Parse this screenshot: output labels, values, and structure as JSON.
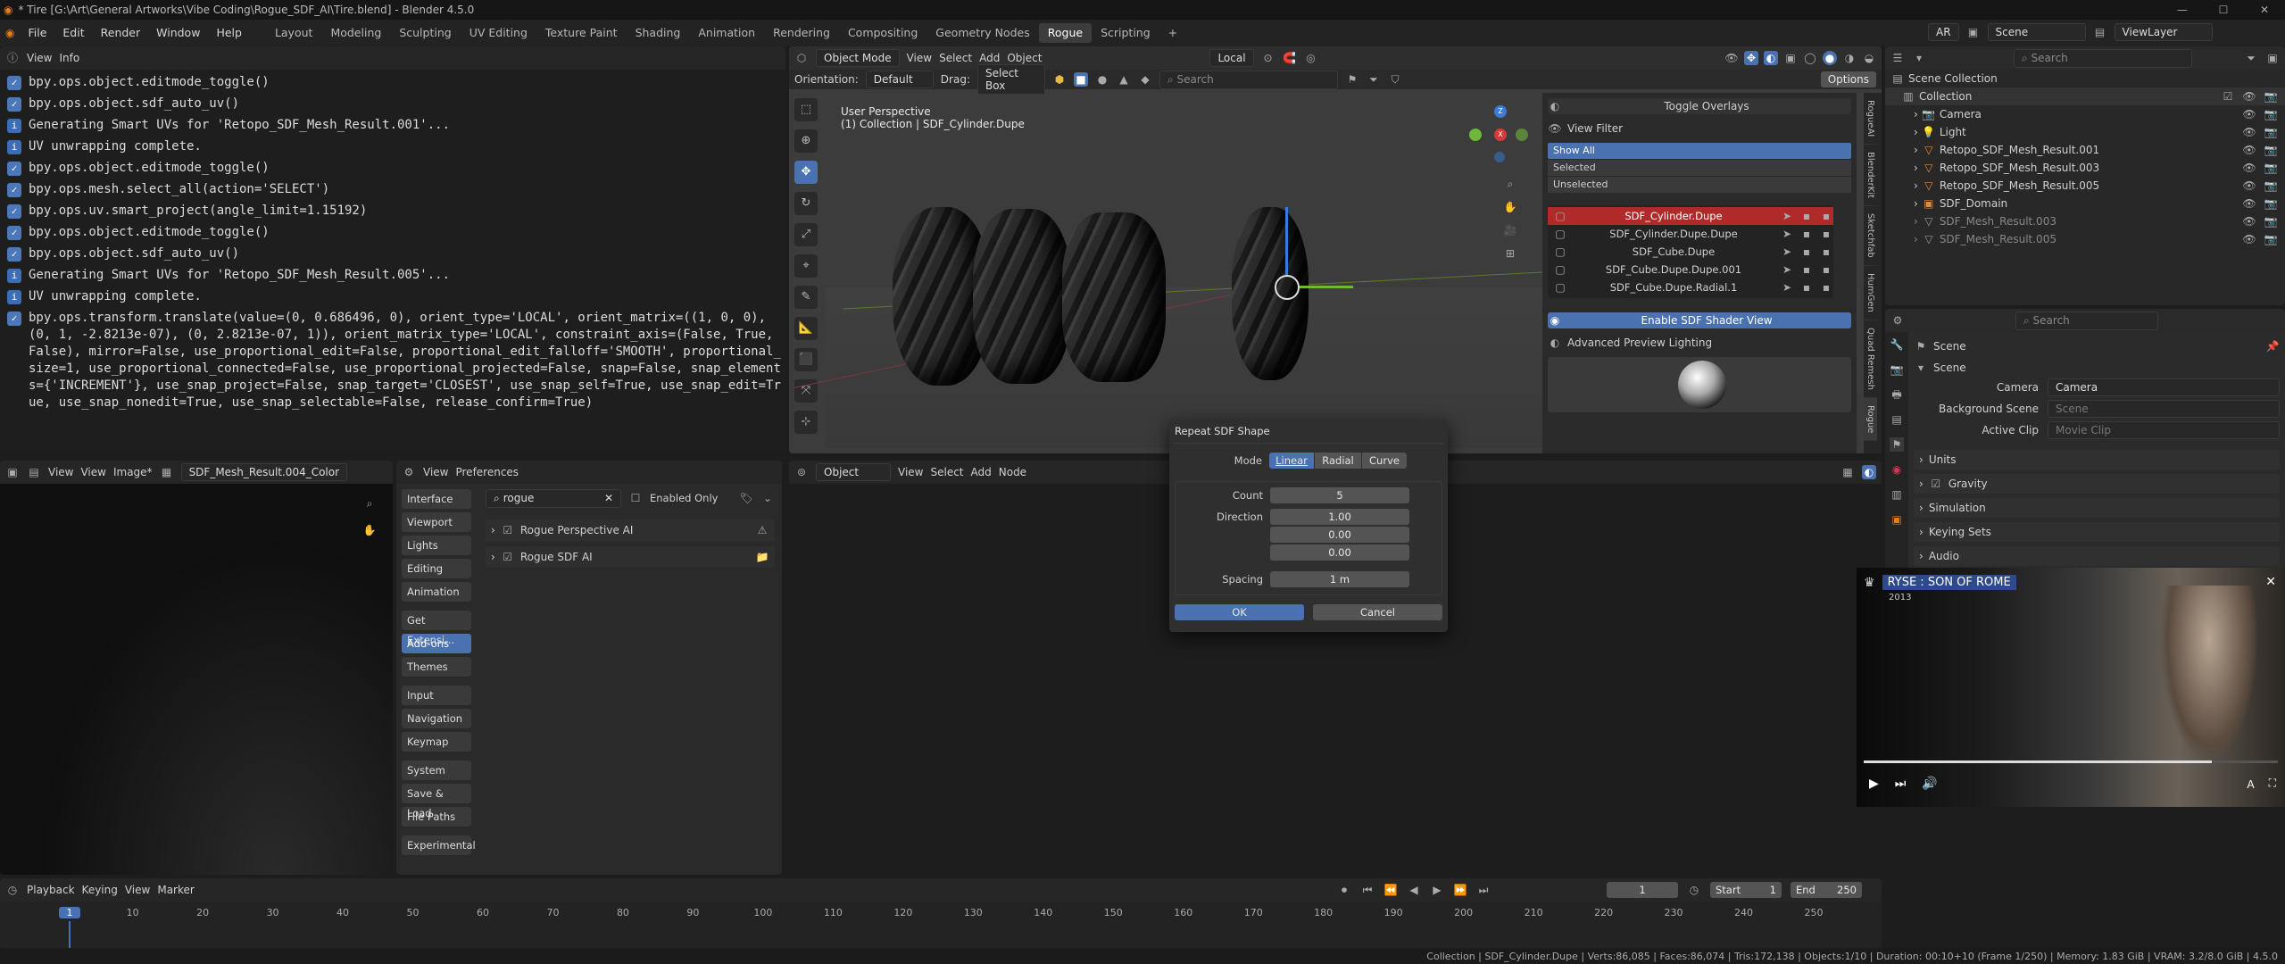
{
  "window": {
    "title": "* Tire [G:\\Art\\General Artworks\\Vibe Coding\\Rogue_SDF_AI\\Tire.blend] - Blender 4.5.0"
  },
  "menu": [
    "File",
    "Edit",
    "Render",
    "Window",
    "Help"
  ],
  "workspaces": [
    "Layout",
    "Modeling",
    "Sculpting",
    "UV Editing",
    "Texture Paint",
    "Shading",
    "Animation",
    "Rendering",
    "Compositing",
    "Geometry Nodes",
    "Rogue",
    "Scripting"
  ],
  "topright": {
    "lang": "AR",
    "scene": "Scene",
    "viewlayer": "ViewLayer"
  },
  "console": {
    "header": [
      "View",
      "Info"
    ],
    "lines": [
      {
        "type": "op",
        "text": "bpy.ops.object.editmode_toggle()"
      },
      {
        "type": "op",
        "text": "bpy.ops.object.sdf_auto_uv()"
      },
      {
        "type": "info",
        "text": "Generating Smart UVs for 'Retopo_SDF_Mesh_Result.001'..."
      },
      {
        "type": "info",
        "text": "UV unwrapping complete."
      },
      {
        "type": "op",
        "text": "bpy.ops.object.editmode_toggle()"
      },
      {
        "type": "op",
        "text": "bpy.ops.mesh.select_all(action='SELECT')"
      },
      {
        "type": "op",
        "text": "bpy.ops.uv.smart_project(angle_limit=1.15192)"
      },
      {
        "type": "op",
        "text": "bpy.ops.object.editmode_toggle()"
      },
      {
        "type": "op",
        "text": "bpy.ops.object.sdf_auto_uv()"
      },
      {
        "type": "info",
        "text": "Generating Smart UVs for 'Retopo_SDF_Mesh_Result.005'..."
      },
      {
        "type": "info",
        "text": "UV unwrapping complete."
      },
      {
        "type": "op",
        "text": "bpy.ops.transform.translate(value=(0, 0.686496, 0), orient_type='LOCAL', orient_matrix=((1, 0, 0), (0, 1, -2.8213e-07), (0, 2.8213e-07, 1)), orient_matrix_type='LOCAL', constraint_axis=(False, True, False), mirror=False, use_proportional_edit=False, proportional_edit_falloff='SMOOTH', proportional_size=1, use_proportional_connected=False, use_proportional_projected=False, snap=False, snap_elements={'INCREMENT'}, use_snap_project=False, snap_target='CLOSEST', use_snap_self=True, use_snap_edit=True, use_snap_nonedit=True, use_snap_selectable=False, release_confirm=True)"
      }
    ]
  },
  "viewport": {
    "mode": "Object Mode",
    "menus": [
      "View",
      "Select",
      "Add",
      "Object"
    ],
    "orientation_label": "Orientation:",
    "orientation": "Default",
    "drag_label": "Drag:",
    "drag": "Select Box",
    "transform": "Local",
    "search_placeholder": "Search",
    "options": "Options",
    "overlay_line1": "User Perspective",
    "overlay_line2": "(1) Collection | SDF_Cylinder.Dupe"
  },
  "npanel": {
    "toggle_overlays": "Toggle Overlays",
    "view_filter": "View Filter",
    "filters": [
      "Show All",
      "Selected",
      "Unselected"
    ],
    "objects": [
      "SDF_Cylinder.Dupe",
      "SDF_Cylinder.Dupe.Dupe",
      "SDF_Cube.Dupe",
      "SDF_Cube.Dupe.Dupe.001",
      "SDF_Cube.Dupe.Radial.1"
    ],
    "enable_shader": "Enable SDF Shader View",
    "adv_preview": "Advanced Preview Lighting",
    "tabs": [
      "RogueAI",
      "BlenderKit",
      "Sketchfab",
      "HumGen",
      "Quad Remesh",
      "Rogue"
    ]
  },
  "outliner": {
    "search": "Search",
    "root": "Scene Collection",
    "collection": "Collection",
    "items": [
      "Camera",
      "Light",
      "Retopo_SDF_Mesh_Result.001",
      "Retopo_SDF_Mesh_Result.003",
      "Retopo_SDF_Mesh_Result.005",
      "SDF_Domain",
      "SDF_Mesh_Result.003",
      "SDF_Mesh_Result.005"
    ]
  },
  "properties": {
    "search": "Search",
    "title": "Scene",
    "section": "Scene",
    "camera_label": "Camera",
    "camera": "Camera",
    "bg_label": "Background Scene",
    "bg": "Scene",
    "clip_label": "Active Clip",
    "clip": "Movie Clip",
    "panels": [
      "Units",
      "Gravity",
      "Simulation",
      "Keying Sets",
      "Audio"
    ]
  },
  "imageeditor": {
    "menus": [
      "View",
      "View",
      "Image*"
    ],
    "image": "SDF_Mesh_Result.004_Color"
  },
  "prefs": {
    "menus": [
      "View",
      "Preferences"
    ],
    "search": "rogue",
    "enabled_only": "Enabled Only",
    "nav": [
      "Interface",
      "Viewport",
      "Lights",
      "Editing",
      "Animation",
      "Get Extensi...",
      "Add-ons",
      "Themes",
      "Input",
      "Navigation",
      "Keymap",
      "System",
      "Save & Load",
      "File Paths",
      "Experimental"
    ],
    "addons": [
      "Rogue Perspective AI",
      "Rogue SDF AI"
    ]
  },
  "nodeeditor": {
    "type": "Object",
    "menus": [
      "View",
      "Select",
      "Add",
      "Node"
    ]
  },
  "dialog": {
    "title": "Repeat SDF Shape",
    "mode_label": "Mode",
    "modes": [
      "Linear",
      "Radial",
      "Curve"
    ],
    "count_label": "Count",
    "count": "5",
    "direction_label": "Direction",
    "direction": [
      "1.00",
      "0.00",
      "0.00"
    ],
    "spacing_label": "Spacing",
    "spacing": "1 m",
    "ok": "OK",
    "cancel": "Cancel"
  },
  "video": {
    "title": "RYSE : SON OF ROME",
    "year": "2013"
  },
  "timeline": {
    "menus": [
      "Playback",
      "Keying",
      "View",
      "Marker"
    ],
    "frame": "1",
    "start_label": "Start",
    "start": "1",
    "end_label": "End",
    "end": "250",
    "ticks": [
      "1",
      "10",
      "20",
      "30",
      "40",
      "50",
      "60",
      "70",
      "80",
      "90",
      "100",
      "110",
      "120",
      "130",
      "140",
      "150",
      "160",
      "170",
      "180",
      "190",
      "200",
      "210",
      "220",
      "230",
      "240",
      "250"
    ]
  },
  "status": {
    "text": "Collection | SDF_Cylinder.Dupe | Verts:86,085 | Faces:86,074 | Tris:172,138 | Objects:1/10 | Duration: 00:10+10 (Frame 1/250) | Memory: 1.83 GiB | VRAM: 3.2/8.0 GiB | 4.5.0"
  },
  "colors": {
    "accent": "#4a72b0",
    "selected_row": "#b02a2a"
  }
}
